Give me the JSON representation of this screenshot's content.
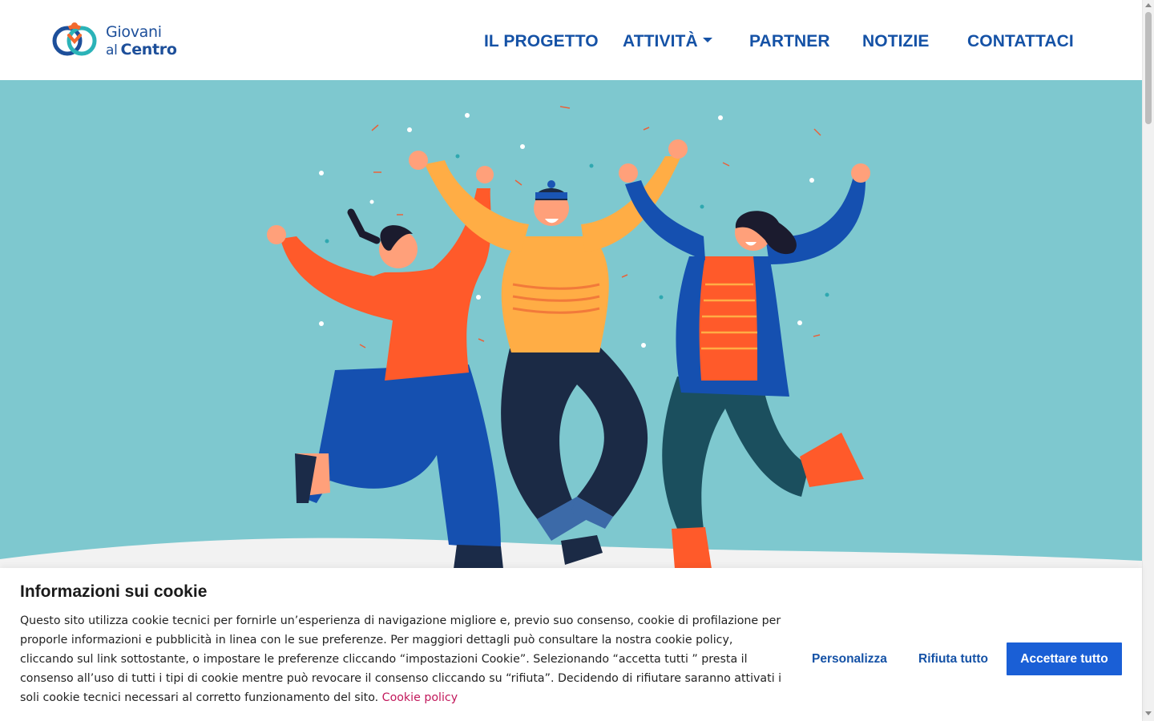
{
  "logo": {
    "line1": "Giovani",
    "line2_small": "al",
    "line2_big": "Centro"
  },
  "nav": {
    "items": [
      {
        "label": "IL PROGETTO"
      },
      {
        "label": "ATTIVITÀ",
        "has_dropdown": true
      },
      {
        "label": "PARTNER"
      },
      {
        "label": "NOTIZIE"
      },
      {
        "label": "CONTATTACI"
      }
    ]
  },
  "hero": {
    "illustration": "three-people-jumping-celebrating",
    "background_color": "#7ec8cf"
  },
  "cookie_banner": {
    "title": "Informazioni sui cookie",
    "text": "Questo sito utilizza cookie tecnici per fornirle un’esperienza di navigazione migliore e, previo suo consenso, cookie di profilazione per proporle informazioni e pubblicità in linea con le sue preferenze. Per maggiori dettagli può consultare la nostra cookie policy, cliccando sul link sottostante, o impostare le preferenze cliccando “impostazioni Cookie”. Selezionando “accetta tutti ” presta il consenso all’uso di tutti i tipi di cookie mentre può revocare il consenso cliccando su “rifiuta”. Decidendo di rifiutare saranno attivati i soli cookie tecnici necessari al corretto funzionamento del sito.",
    "policy_link": "Cookie policy",
    "buttons": {
      "customize": "Personalizza",
      "reject": "Rifiuta tutto",
      "accept": "Accettare tutto"
    }
  },
  "colors": {
    "brand_blue": "#1552a6",
    "accent_pink": "#c2185b",
    "primary_button": "#1a5fd6",
    "hero_bg": "#7ec8cf"
  }
}
